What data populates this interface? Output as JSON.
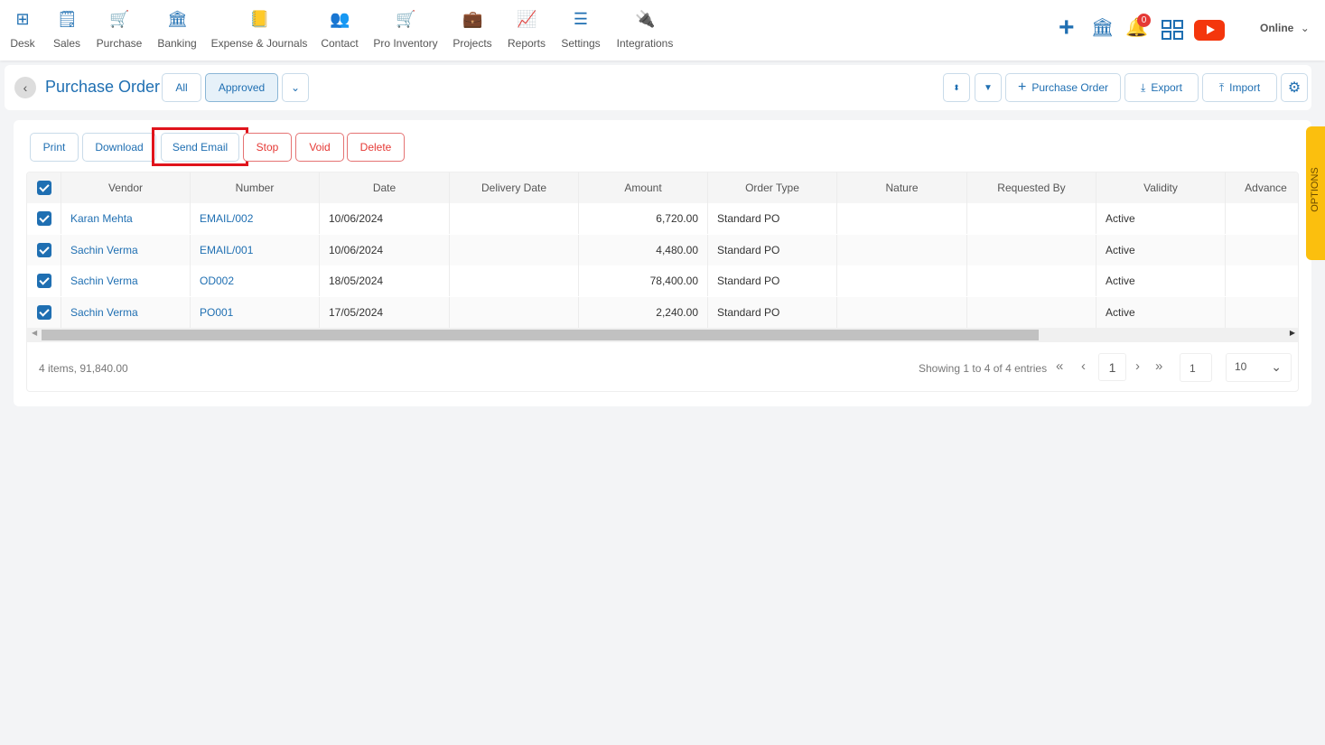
{
  "nav": [
    {
      "label": "Desk",
      "icon": "desk-icon"
    },
    {
      "label": "Sales",
      "icon": "sales-icon"
    },
    {
      "label": "Purchase",
      "icon": "cart-icon"
    },
    {
      "label": "Banking",
      "icon": "bank-icon"
    },
    {
      "label": "Expense & Journals",
      "icon": "journal-icon"
    },
    {
      "label": "Contact",
      "icon": "contact-icon"
    },
    {
      "label": "Pro Inventory",
      "icon": "inventory-icon"
    },
    {
      "label": "Projects",
      "icon": "projects-icon"
    },
    {
      "label": "Reports",
      "icon": "reports-icon"
    },
    {
      "label": "Settings",
      "icon": "settings-sliders-icon"
    },
    {
      "label": "Integrations",
      "icon": "plug-icon"
    }
  ],
  "top_right": {
    "notification_count": "0",
    "status": "Online"
  },
  "header": {
    "title": "Purchase Order",
    "tab_all": "All",
    "tab_approved": "Approved",
    "new_label": "Purchase Order",
    "export": "Export",
    "import": "Import"
  },
  "actions": {
    "print": "Print",
    "download": "Download",
    "send_email": "Send Email",
    "stop": "Stop",
    "void": "Void",
    "delete": "Delete"
  },
  "table": {
    "columns": [
      "Vendor",
      "Number",
      "Date",
      "Delivery Date",
      "Amount",
      "Order Type",
      "Nature",
      "Requested By",
      "Validity",
      "Advance"
    ],
    "rows": [
      {
        "vendor": "Karan Mehta",
        "number": "EMAIL/002",
        "date": "10/06/2024",
        "delivery": "",
        "amount": "6,720.00",
        "type": "Standard PO",
        "nature": "",
        "requested": "",
        "validity": "Active",
        "advance": ""
      },
      {
        "vendor": "Sachin Verma",
        "number": "EMAIL/001",
        "date": "10/06/2024",
        "delivery": "",
        "amount": "4,480.00",
        "type": "Standard PO",
        "nature": "",
        "requested": "",
        "validity": "Active",
        "advance": ""
      },
      {
        "vendor": "Sachin Verma",
        "number": "OD002",
        "date": "18/05/2024",
        "delivery": "",
        "amount": "78,400.00",
        "type": "Standard PO",
        "nature": "",
        "requested": "",
        "validity": "Active",
        "advance": ""
      },
      {
        "vendor": "Sachin Verma",
        "number": "PO001",
        "date": "17/05/2024",
        "delivery": "",
        "amount": "2,240.00",
        "type": "Standard PO",
        "nature": "",
        "requested": "",
        "validity": "Active",
        "advance": ""
      }
    ]
  },
  "footer": {
    "summary": "4 items, 91,840.00",
    "showing": "Showing 1 to 4 of 4 entries",
    "page": "1",
    "goto": "1",
    "page_size": "10"
  },
  "options_tab": "OPTIONS",
  "colors": {
    "primary": "#1f6fb2",
    "danger": "#e53935",
    "options": "#fbbf0e",
    "highlight": "#e0141c"
  }
}
